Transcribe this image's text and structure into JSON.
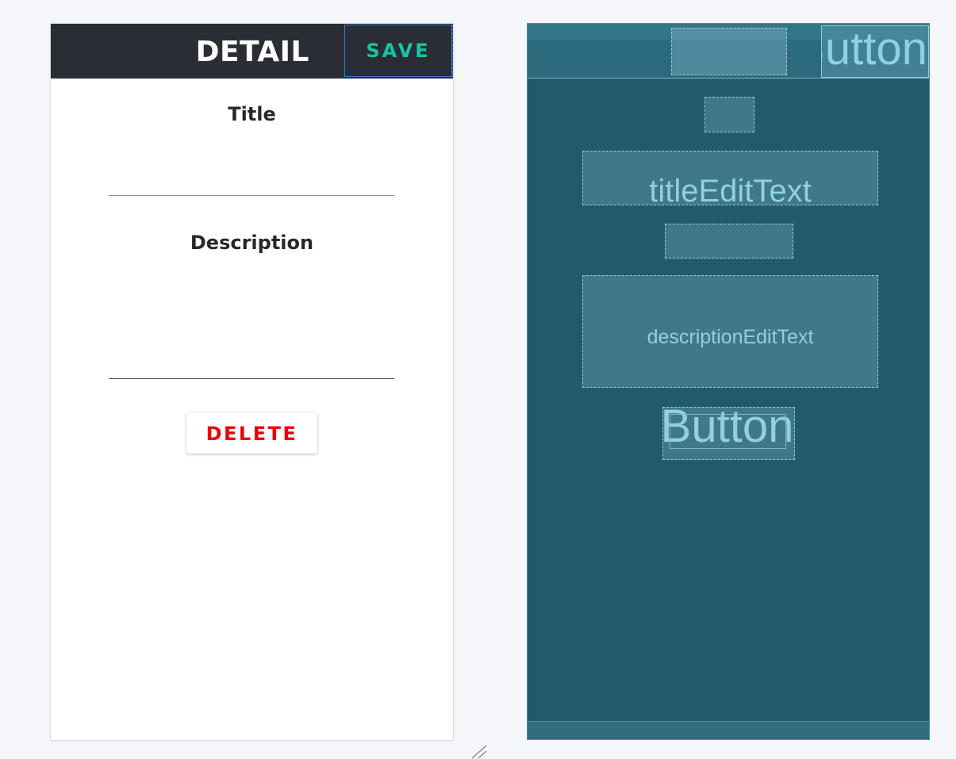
{
  "design": {
    "toolbar": {
      "title": "DETAIL",
      "save_label": "SAVE"
    },
    "title_label": "Title",
    "description_label": "Description",
    "delete_label": "DELETE"
  },
  "blueprint": {
    "save_button_text": "Button",
    "title_edit_text": "titleEditText",
    "description_edit_text": "descriptionEditText",
    "delete_button_text": "Button"
  },
  "colors": {
    "toolbar_bg": "#2a2d33",
    "save_text": "#19c4a6",
    "delete_text": "#e8000b",
    "blueprint_bg": "#225a6c",
    "blueprint_text": "#8fd0e2"
  }
}
